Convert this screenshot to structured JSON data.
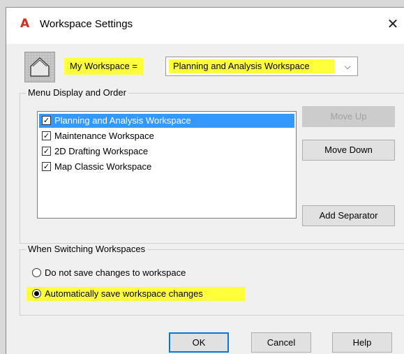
{
  "dialog": {
    "title": "Workspace Settings",
    "app_icon_glyph": "A",
    "close_glyph": "✕"
  },
  "my_workspace": {
    "label": "My Workspace =",
    "selected": "Planning and Analysis Workspace",
    "arrow_glyph": "⌵"
  },
  "menu_group": {
    "label": "Menu Display and Order",
    "items": [
      {
        "label": "Planning and Analysis Workspace",
        "checked": true,
        "selected": true
      },
      {
        "label": "Maintenance Workspace",
        "checked": true,
        "selected": false
      },
      {
        "label": "2D Drafting Workspace",
        "checked": true,
        "selected": false
      },
      {
        "label": "Map Classic Workspace",
        "checked": true,
        "selected": false
      }
    ],
    "check_glyph": "✓",
    "move_up": "Move Up",
    "move_down": "Move Down",
    "add_separator": "Add Separator"
  },
  "switch_group": {
    "label": "When Switching Workspaces",
    "option_no_save": "Do not save changes to workspace",
    "option_auto_save": "Automatically save workspace changes",
    "selected_option": "auto_save"
  },
  "footer": {
    "ok": "OK",
    "cancel": "Cancel",
    "help": "Help"
  },
  "colors": {
    "highlight": "#ffff3c",
    "selection": "#3399ff",
    "app_icon": "#d52b1e",
    "default_button_border": "#0078d7"
  }
}
